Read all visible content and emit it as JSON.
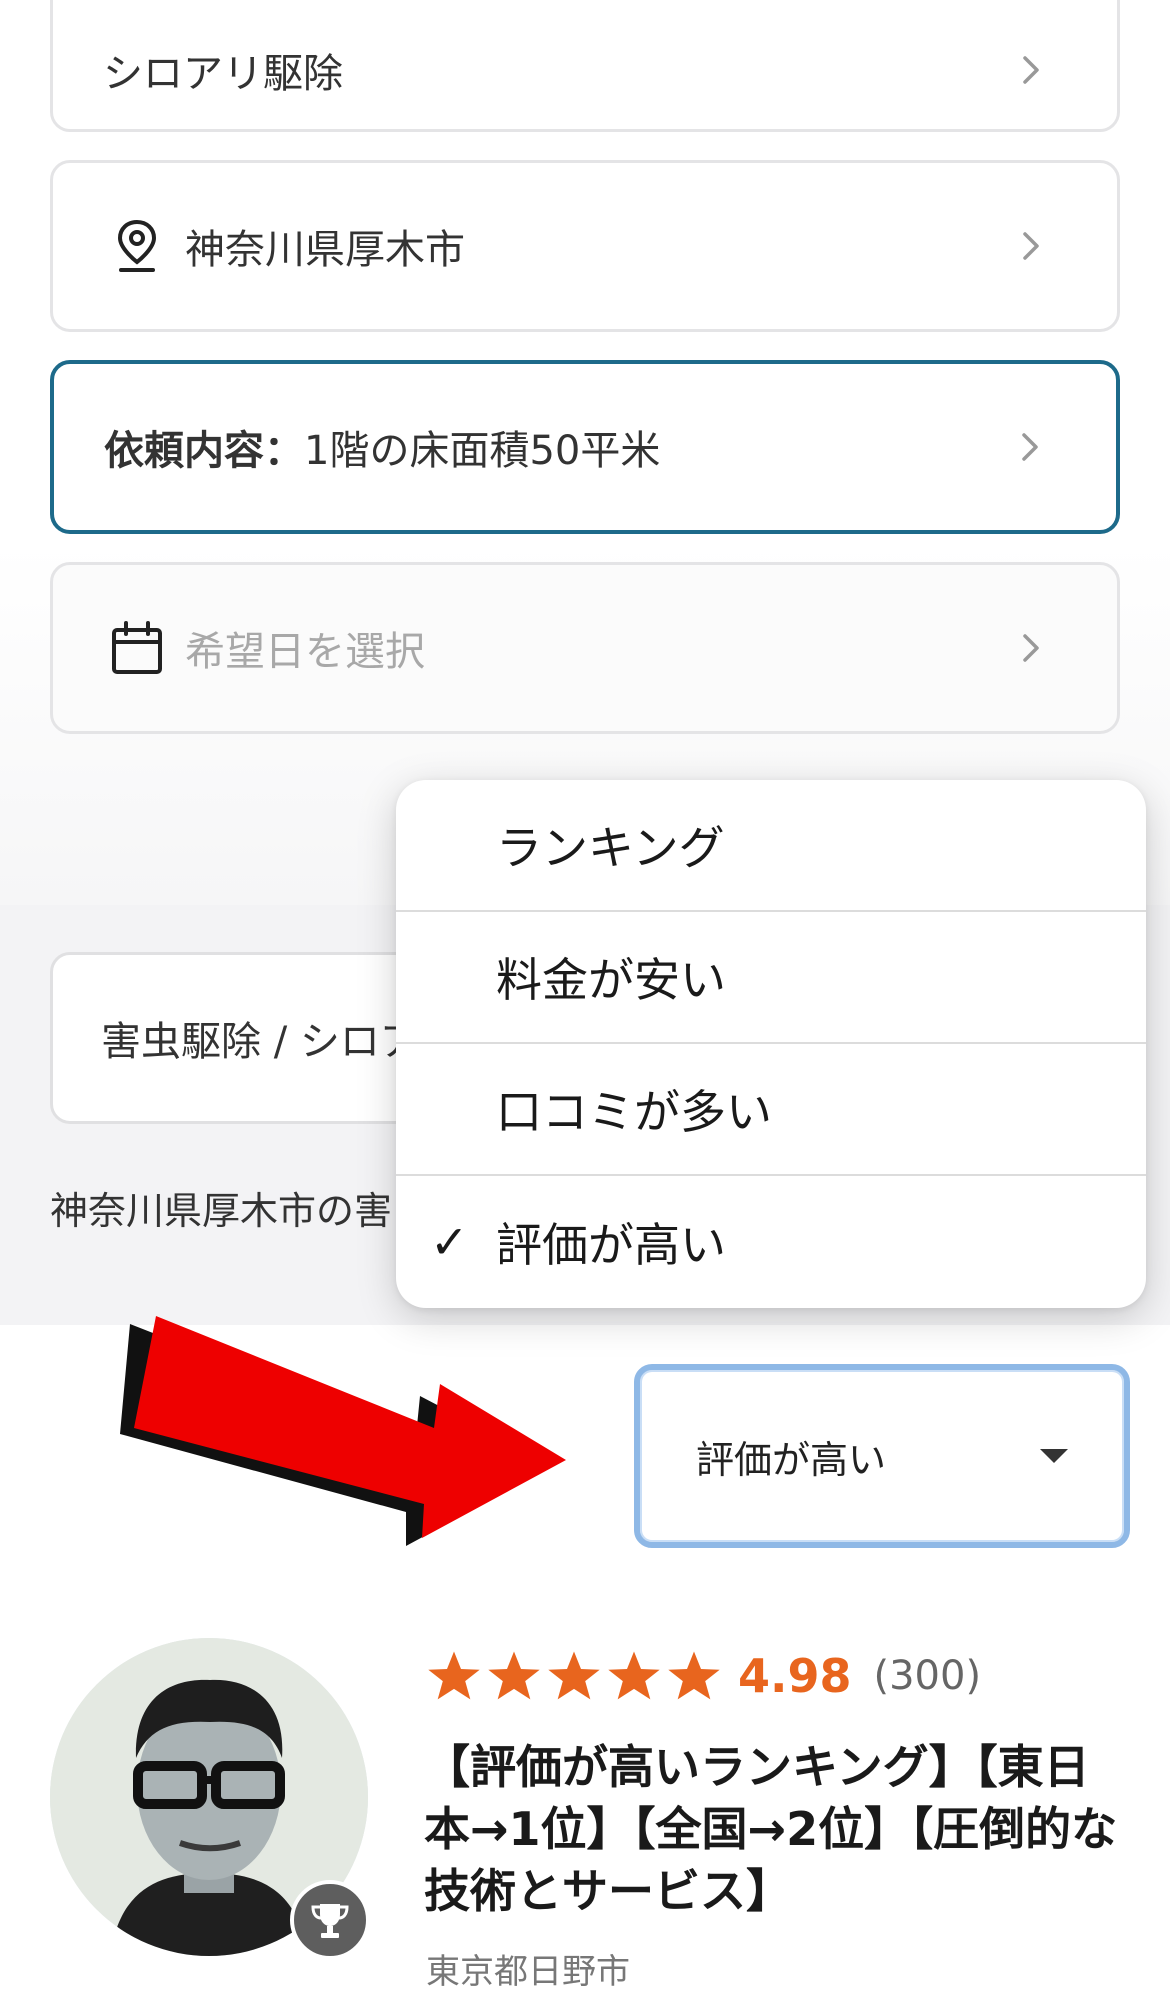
{
  "form": {
    "category": "シロアリ駆除",
    "location": "神奈川県厚木市",
    "request_label": "依頼内容：",
    "request_value": "1階の床面積50平米",
    "date_placeholder": "希望日を選択"
  },
  "results": {
    "service_filter": "害虫駆除 / シロアリ",
    "area_text": "神奈川県厚木市の害"
  },
  "sort_menu": {
    "options": [
      "ランキング",
      "料金が安い",
      "口コミが多い",
      "評価が高い"
    ],
    "selected_index": 3,
    "check_mark": "✓"
  },
  "sort_select": {
    "value": "評価が高い"
  },
  "pro": {
    "rating_stars": 5,
    "rating_value": "4.98",
    "review_count": "(300)",
    "title": "【評価が高いランキング】【東日本→1位】【全国→2位】【圧倒的な技術とサービス】",
    "location": "東京都日野市"
  },
  "colors": {
    "accent_orange": "#e8651e",
    "request_border": "#1d6a8a",
    "select_border": "#8eb8e6",
    "arrow_red": "#ee0000"
  }
}
